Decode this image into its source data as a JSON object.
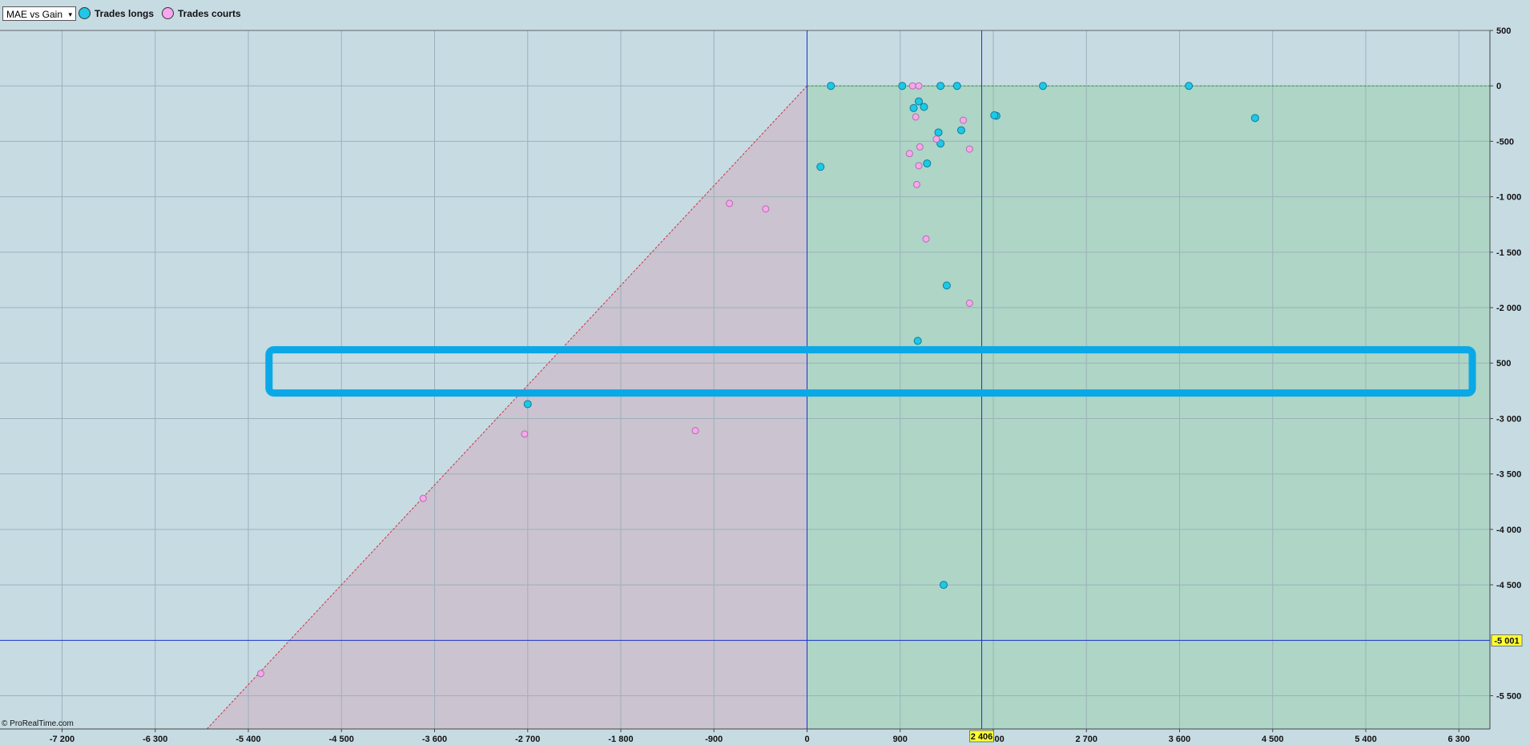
{
  "toolbar": {
    "select_label": "MAE vs Gain",
    "select_caret": "▾"
  },
  "legend": [
    {
      "label": "Trades longs",
      "color": "#1ec8e6"
    },
    {
      "label": "Trades courts",
      "color": "#f7a6ef"
    }
  ],
  "watermark": "© ProRealTime.com",
  "colors": {
    "background": "#c7dbe3",
    "loss_zone": "#cbbecb",
    "gain_zone": "#a9d4c1",
    "long_marker": "#1ec8e6",
    "short_marker": "#f7a6ef",
    "crosshair": "#1a33cc",
    "highlight": "#0aa8e6",
    "cursor_label_bg": "#ffff33"
  },
  "chart_data": {
    "type": "scatter",
    "title": "MAE vs Gain",
    "xlim": [
      -7800,
      6600
    ],
    "ylim": [
      -5800,
      500
    ],
    "x_ticks": [
      -7200,
      -6300,
      -5400,
      -4500,
      -3600,
      -2700,
      -1800,
      -900,
      0,
      900,
      1800,
      2700,
      3600,
      4500,
      5400,
      6300
    ],
    "x_tick_labels": [
      "-7 200",
      "-6 300",
      "-5 400",
      "-4 500",
      "-3 600",
      "-2 700",
      "-1 800",
      "-900",
      "0",
      "900",
      "1 800",
      "2 700",
      "3 600",
      "4 500",
      "5 400",
      "6 300"
    ],
    "y_ticks": [
      500,
      0,
      -500,
      -1000,
      -1500,
      -2000,
      -2500,
      -3000,
      -3500,
      -4000,
      -4500,
      -5500
    ],
    "y_tick_labels": [
      "500",
      "0",
      "-500",
      "-1 000",
      "-1 500",
      "-2 000",
      "500",
      "-3 000",
      "-3 500",
      "-4 000",
      "-4 500",
      "-5 500"
    ],
    "grid": true,
    "legend_position": "top-left",
    "cursor": {
      "x": 1688,
      "y": -5001,
      "x_label": "2 406",
      "y_label": "-5 001"
    },
    "highlight_band": {
      "x": [
        -5200,
        6600
      ],
      "y": [
        -2770,
        -2380
      ]
    },
    "series": [
      {
        "name": "Trades longs",
        "points": [
          [
            230,
            0
          ],
          [
            920,
            0
          ],
          [
            1290,
            0
          ],
          [
            1450,
            0
          ],
          [
            2280,
            0
          ],
          [
            3690,
            0
          ],
          [
            1080,
            -140
          ],
          [
            1130,
            -190
          ],
          [
            1030,
            -200
          ],
          [
            1830,
            -270
          ],
          [
            1810,
            -265
          ],
          [
            4330,
            -290
          ],
          [
            1270,
            -420
          ],
          [
            1490,
            -400
          ],
          [
            1290,
            -520
          ],
          [
            1160,
            -700
          ],
          [
            130,
            -730
          ],
          [
            1350,
            -1800
          ],
          [
            1070,
            -2300
          ],
          [
            -2700,
            -2870
          ],
          [
            1320,
            -4500
          ]
        ]
      },
      {
        "name": "Trades courts",
        "points": [
          [
            1020,
            0
          ],
          [
            1080,
            0
          ],
          [
            1050,
            -280
          ],
          [
            1510,
            -310
          ],
          [
            1250,
            -480
          ],
          [
            1090,
            -550
          ],
          [
            990,
            -610
          ],
          [
            1570,
            -570
          ],
          [
            1080,
            -720
          ],
          [
            1060,
            -890
          ],
          [
            -750,
            -1060
          ],
          [
            -400,
            -1110
          ],
          [
            1150,
            -1380
          ],
          [
            1570,
            -1960
          ],
          [
            -1080,
            -3110
          ],
          [
            -2730,
            -3140
          ],
          [
            -3710,
            -3720
          ],
          [
            -5280,
            -5300
          ]
        ]
      }
    ]
  }
}
